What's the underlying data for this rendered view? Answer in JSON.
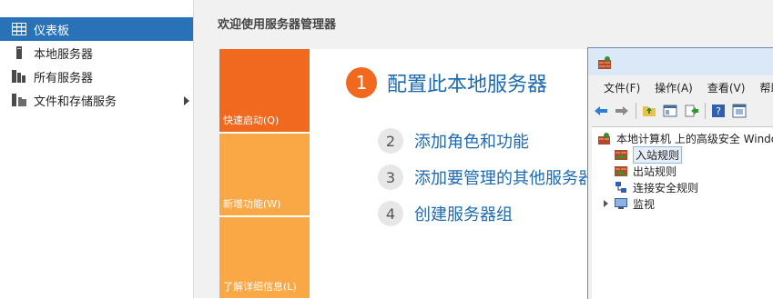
{
  "sidebar": {
    "items": [
      {
        "label": "仪表板",
        "icon": "dashboard-icon",
        "selected": true
      },
      {
        "label": "本地服务器",
        "icon": "local-server-icon"
      },
      {
        "label": "所有服务器",
        "icon": "all-servers-icon"
      },
      {
        "label": "文件和存储服务",
        "icon": "file-storage-icon",
        "has_submenu": true
      }
    ]
  },
  "main": {
    "welcome_title": "欢迎使用服务器管理器",
    "tiles": [
      "快速启动(Q)",
      "新增功能(W)",
      "了解详细信息(L)"
    ],
    "steps": [
      {
        "num": "1",
        "label": "配置此本地服务器"
      },
      {
        "num": "2",
        "label": "添加角色和功能"
      },
      {
        "num": "3",
        "label": "添加要管理的其他服务器"
      },
      {
        "num": "4",
        "label": "创建服务器组"
      }
    ]
  },
  "firewall_window": {
    "menu": [
      "文件(F)",
      "操作(A)",
      "查看(V)",
      "帮助"
    ],
    "toolbar_icons": [
      "back-icon",
      "forward-icon",
      "up-folder-icon",
      "show-hide-tree-icon",
      "export-icon",
      "help-icon",
      "properties-icon"
    ],
    "tree": {
      "root": "本地计算机 上的高级安全 Windows 防火墙",
      "items": [
        {
          "label": "入站规则",
          "selected": true
        },
        {
          "label": "出站规则"
        },
        {
          "label": "连接安全规则"
        },
        {
          "label": "监视",
          "expandable": true
        }
      ]
    }
  },
  "colors": {
    "selected_nav": "#2a72b8",
    "tile_primary": "#f0691f",
    "tile_secondary": "#faa846",
    "link_blue": "#1d6aaf"
  }
}
